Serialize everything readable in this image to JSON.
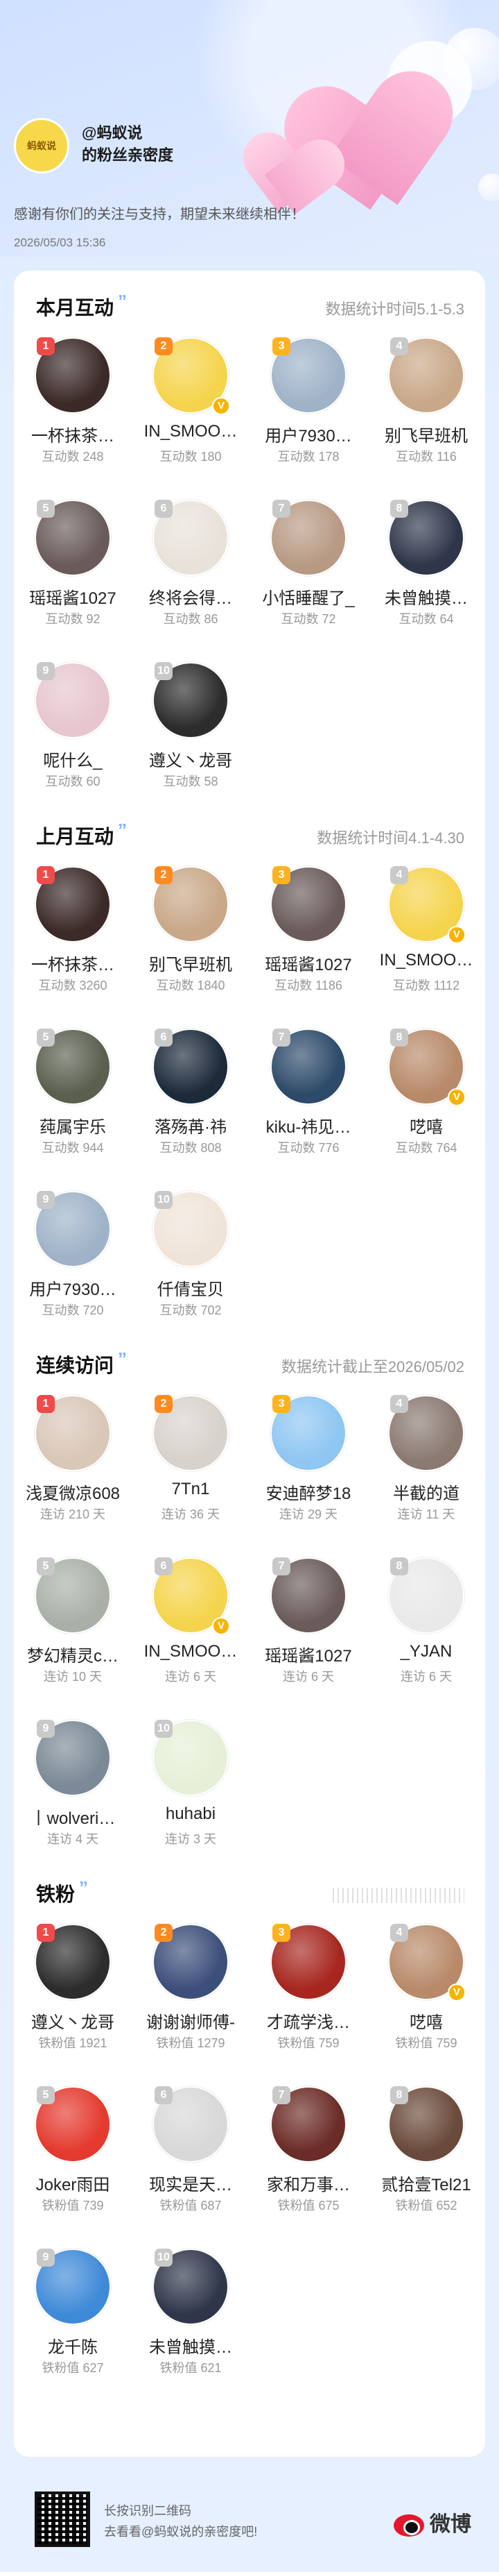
{
  "header": {
    "logo_text": "蚂蚁说",
    "title": "@蚂蚁说",
    "subtitle": "的粉丝亲密度",
    "thanks": "感谢有你们的关注与支持，期望未来继续相伴！",
    "date": "2026/05/03  15:36"
  },
  "colors": {
    "rank1": "#f04a4a",
    "rank2": "#ff8a1f",
    "rank3": "#ffb21f",
    "rank_other": "#c9c9c9",
    "accent": "#7fb4ff"
  },
  "sections": [
    {
      "title": "本月互动",
      "meta": "数据统计时间5.1-5.3",
      "stat_label": "互动数",
      "fans": [
        {
          "rank": "1",
          "name": "一杯抹茶…",
          "value": "248",
          "color": "#3b2a28"
        },
        {
          "rank": "2",
          "name": "IN_SMOO…",
          "value": "180",
          "color": "#f5d44d",
          "v": true
        },
        {
          "rank": "3",
          "name": "用户7930…",
          "value": "178",
          "color": "#9fb3c8"
        },
        {
          "rank": "4",
          "name": "别飞早班机",
          "value": "116",
          "color": "#c9a889"
        },
        {
          "rank": "5",
          "name": "瑶瑶酱1027",
          "value": "92",
          "color": "#6a5b5a"
        },
        {
          "rank": "6",
          "name": "终将会得…",
          "value": "86",
          "color": "#e8e2da"
        },
        {
          "rank": "7",
          "name": "小恬睡醒了_",
          "value": "72",
          "color": "#b89a84"
        },
        {
          "rank": "8",
          "name": "未曾触摸…",
          "value": "64",
          "color": "#30364a"
        },
        {
          "rank": "9",
          "name": "呢什么_",
          "value": "60",
          "color": "#e7c6cf"
        },
        {
          "rank": "10",
          "name": "遵义丶龙哥",
          "value": "58",
          "color": "#2c2c2c"
        }
      ]
    },
    {
      "title": "上月互动",
      "meta": "数据统计时间4.1-4.30",
      "stat_label": "互动数",
      "fans": [
        {
          "rank": "1",
          "name": "一杯抹茶…",
          "value": "3260",
          "color": "#3b2a28"
        },
        {
          "rank": "2",
          "name": "别飞早班机",
          "value": "1840",
          "color": "#c9a889"
        },
        {
          "rank": "3",
          "name": "瑶瑶酱1027",
          "value": "1186",
          "color": "#6a5b5a"
        },
        {
          "rank": "4",
          "name": "IN_SMOO…",
          "value": "1112",
          "color": "#f5d44d",
          "v": true
        },
        {
          "rank": "5",
          "name": "莼属宇乐",
          "value": "944",
          "color": "#5a5f4e"
        },
        {
          "rank": "6",
          "name": "落殇苒·祎",
          "value": "808",
          "color": "#1c2a3a"
        },
        {
          "rank": "7",
          "name": "kiku-祎见…",
          "value": "776",
          "color": "#2d4a6a"
        },
        {
          "rank": "8",
          "name": "呓嘻",
          "value": "764",
          "color": "#b88a6a",
          "v": true
        },
        {
          "rank": "9",
          "name": "用户7930…",
          "value": "720",
          "color": "#9fb3c8"
        },
        {
          "rank": "10",
          "name": "仟倩宝贝",
          "value": "702",
          "color": "#f0e4d8"
        }
      ]
    },
    {
      "title": "连续访问",
      "meta": "数据统计截止至2026/05/02",
      "stat_label": "连访",
      "stat_unit": "天",
      "fans": [
        {
          "rank": "1",
          "name": "浅夏微凉608",
          "value": "210",
          "color": "#d9c7b8"
        },
        {
          "rank": "2",
          "name": "7Tn1",
          "value": "36",
          "color": "#d8d2cc"
        },
        {
          "rank": "3",
          "name": "安迪醉梦18",
          "value": "29",
          "color": "#8fc6f2"
        },
        {
          "rank": "4",
          "name": "半截的道",
          "value": "11",
          "color": "#8a7a72"
        },
        {
          "rank": "5",
          "name": "梦幻精灵c…",
          "value": "10",
          "color": "#aab0a8"
        },
        {
          "rank": "6",
          "name": "IN_SMOO…",
          "value": "6",
          "color": "#f5d44d",
          "v": true
        },
        {
          "rank": "7",
          "name": "瑶瑶酱1027",
          "value": "6",
          "color": "#6a5b5a"
        },
        {
          "rank": "8",
          "name": "_YJAN",
          "value": "6",
          "color": "#e9e9e9"
        },
        {
          "rank": "9",
          "name": "丨wolveri…",
          "value": "4",
          "color": "#7b8a96"
        },
        {
          "rank": "10",
          "name": "huhabi",
          "value": "3",
          "color": "#e6f0d8"
        }
      ]
    },
    {
      "title": "铁粉",
      "meta": "",
      "stat_label": "铁粉值",
      "fans": [
        {
          "rank": "1",
          "name": "遵义丶龙哥",
          "value": "1921",
          "color": "#2c2c2c"
        },
        {
          "rank": "2",
          "name": "谢谢谢师傅-",
          "value": "1279",
          "color": "#3c4f7a"
        },
        {
          "rank": "3",
          "name": "才疏学浅…",
          "value": "759",
          "color": "#a7261f"
        },
        {
          "rank": "4",
          "name": "呓嘻",
          "value": "759",
          "color": "#b88a6a",
          "v": true
        },
        {
          "rank": "5",
          "name": "Joker雨田",
          "value": "739",
          "color": "#e43a2f"
        },
        {
          "rank": "6",
          "name": "现实是天…",
          "value": "687",
          "color": "#d8d8d8"
        },
        {
          "rank": "7",
          "name": "家和万事…",
          "value": "675",
          "color": "#6b2b26"
        },
        {
          "rank": "8",
          "name": "贰拾壹Tel21",
          "value": "652",
          "color": "#6a4a3a"
        },
        {
          "rank": "9",
          "name": "龙千陈",
          "value": "627",
          "color": "#3f8ad8"
        },
        {
          "rank": "10",
          "name": "未曾触摸…",
          "value": "621",
          "color": "#30364a"
        }
      ]
    }
  ],
  "footer": {
    "line1": "长按识别二维码",
    "line2": "去看看@蚂蚁说的亲密度吧!",
    "brand": "微博"
  }
}
